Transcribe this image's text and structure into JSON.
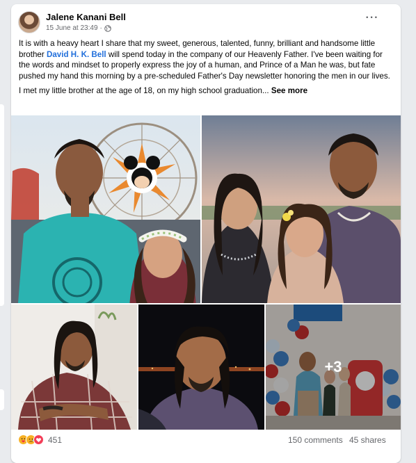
{
  "post": {
    "author": "Jalene Kanani Bell",
    "timestamp": "15 June at 23:49",
    "separator": "·",
    "audience_icon": "globe-icon",
    "more_icon": "ellipsis-icon",
    "paragraph1_part1": "It is with a heavy heart I share that my sweet, generous, talented, funny, brilliant and handsome little brother ",
    "mention": "David H. K. Bell",
    "paragraph1_part2": " will spend today in the company of our Heavenly Father. I've been waiting for the words and mindset to properly express the joy of a human, and Prince of a Man he was, but fate pushed my hand this morning by a pre-scheduled Father's Day newsletter honoring the men in our lives.",
    "paragraph2": "I met my little brother at the age of 18, on my high school graduation...",
    "see_more": "See more"
  },
  "photos": {
    "more_count_label": "+3"
  },
  "footer": {
    "reaction_icons": [
      "care-reaction-icon",
      "sad-reaction-icon",
      "love-reaction-icon"
    ],
    "reaction_count": "451",
    "comments": "150 comments",
    "shares": "45 shares"
  },
  "colors": {
    "mention": "#216fdb",
    "secondary_text": "#65676b",
    "card_bg": "#ffffff",
    "page_bg": "#e9ebee"
  }
}
